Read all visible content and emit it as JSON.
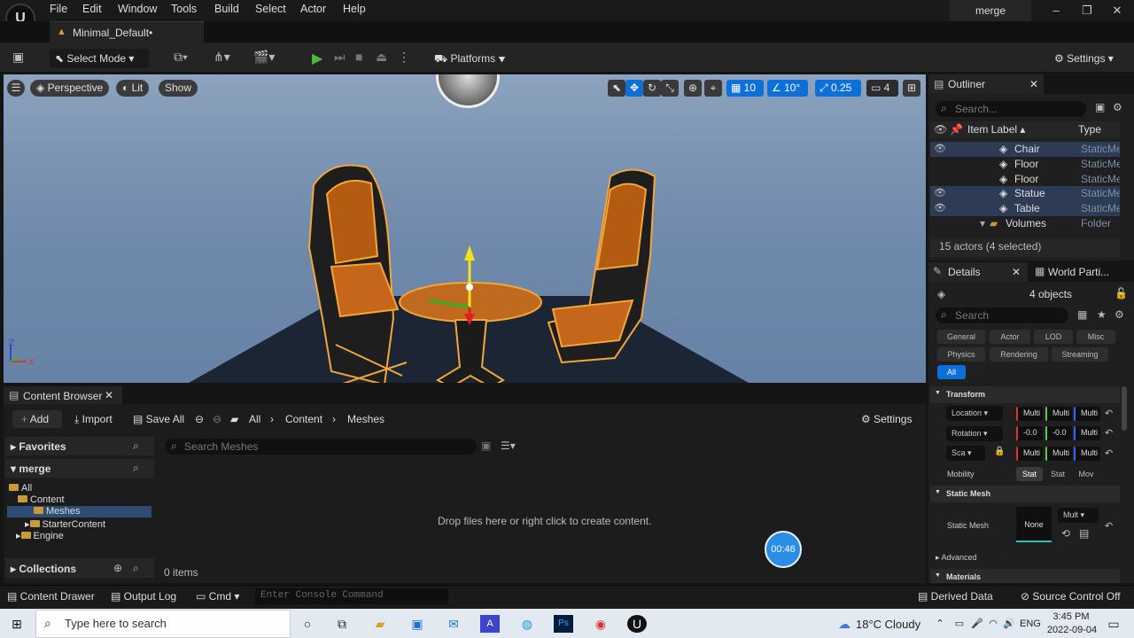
{
  "menu": {
    "logo": "U",
    "items": [
      "File",
      "Edit",
      "Window",
      "Tools",
      "Build",
      "Select",
      "Actor",
      "Help"
    ],
    "project": "merge",
    "doc_tab": "Minimal_Default•"
  },
  "toolbar": {
    "select_mode": "Select Mode",
    "platforms": "Platforms",
    "settings": "Settings"
  },
  "viewport": {
    "perspective": "Perspective",
    "lit": "Lit",
    "show": "Show",
    "grid_snap": "10",
    "rot_snap": "10°",
    "scale_snap": "0.25",
    "cam_speed": "4",
    "axis_z": "Z",
    "axis_x": "X"
  },
  "outliner": {
    "title": "Outliner",
    "search_placeholder": "Search...",
    "col_label": "Item Label",
    "col_type": "Type",
    "rows": [
      {
        "label": "Chair",
        "type": "StaticMe",
        "sel": true
      },
      {
        "label": "Floor",
        "type": "StaticMe",
        "sel": false
      },
      {
        "label": "Floor",
        "type": "StaticMe",
        "sel": false
      },
      {
        "label": "Statue",
        "type": "StaticMe",
        "sel": true
      },
      {
        "label": "Table",
        "type": "StaticMe",
        "sel": true
      },
      {
        "label": "Volumes",
        "type": "Folder",
        "sel": false
      }
    ],
    "status": "15 actors (4 selected)"
  },
  "details": {
    "tab1": "Details",
    "tab2": "World Parti...",
    "objects": "4 objects",
    "search_placeholder": "Search",
    "chips_row1": [
      "General",
      "Actor",
      "LOD",
      "Misc"
    ],
    "chips_row2": [
      "Physics",
      "Rendering",
      "Streaming"
    ],
    "chip_all": "All",
    "transform": "Transform",
    "location": "Location",
    "rotation": "Rotation",
    "scale": "Sca",
    "mobility": "Mobility",
    "loc_vals": [
      "Multi",
      "Multi",
      "Multi"
    ],
    "rot_vals": [
      "-0.0",
      "-0.0",
      "Multi"
    ],
    "scale_vals": [
      "Multi",
      "Multi",
      "Multi"
    ],
    "mobility_opts": [
      "Stat",
      "Stat",
      "Mov"
    ],
    "static_mesh_section": "Static Mesh",
    "static_mesh_label": "Static Mesh",
    "mesh_value": "None",
    "mesh_mult": "Mult",
    "advanced": "Advanced",
    "materials": "Materials"
  },
  "content_browser": {
    "tab": "Content Browser",
    "add": "Add",
    "import": "Import",
    "save_all": "Save All",
    "crumbs": [
      "All",
      "Content",
      "Meshes"
    ],
    "settings": "Settings",
    "favorites": "Favorites",
    "project": "merge",
    "search_placeholder": "Search Meshes",
    "tree": [
      "All",
      "Content",
      "Meshes",
      "StarterContent",
      "Engine"
    ],
    "empty": "Drop files here or right click to create content.",
    "items_count": "0 items",
    "collections": "Collections"
  },
  "statusbar": {
    "content_drawer": "Content Drawer",
    "output_log": "Output Log",
    "cmd": "Cmd",
    "console_placeholder": "Enter Console Command",
    "derived_data": "Derived Data",
    "source_control": "Source Control Off"
  },
  "timer": "00:46",
  "taskbar": {
    "search": "Type here to search",
    "weather": "18°C  Cloudy",
    "lang": "ENG",
    "time": "3:45 PM",
    "date": "2022-09-04"
  }
}
